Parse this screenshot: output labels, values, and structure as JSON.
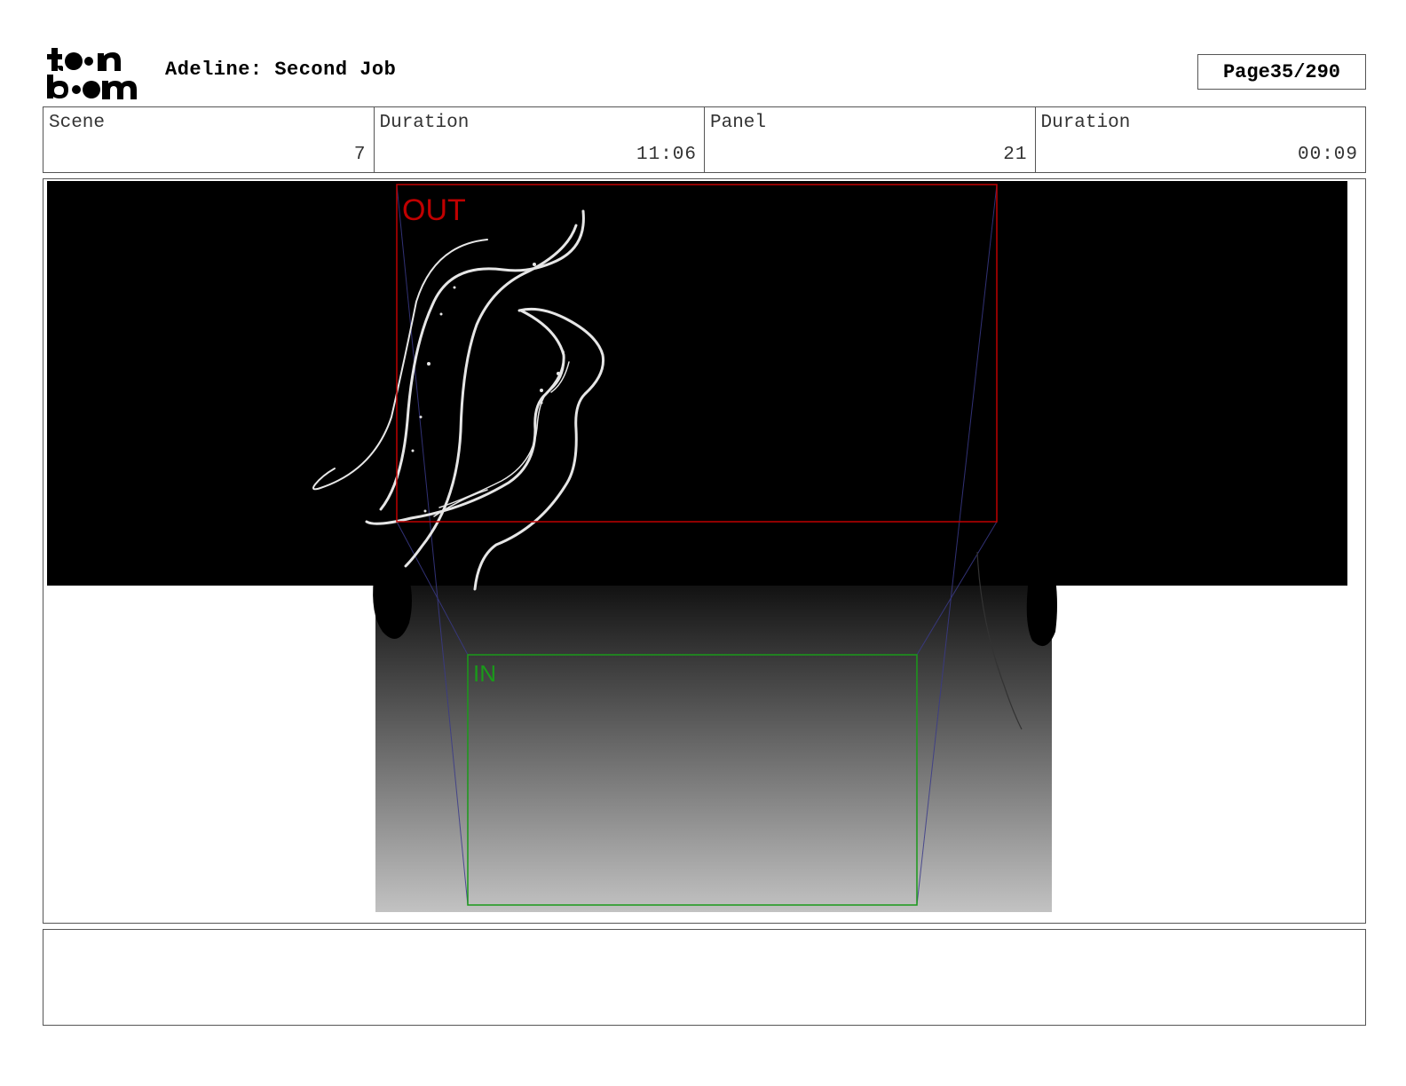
{
  "header": {
    "logo_text": "toon boom",
    "title": "Adeline: Second Job",
    "page_label": "Page",
    "page_value": "35/290"
  },
  "info": {
    "scene_label": "Scene",
    "scene_value": "7",
    "scene_duration_label": "Duration",
    "scene_duration_value": "11:06",
    "panel_label": "Panel",
    "panel_value": "21",
    "panel_duration_label": "Duration",
    "panel_duration_value": "00:09"
  },
  "frame": {
    "out_label": "OUT",
    "in_label": "IN",
    "out_color": "#c00000",
    "in_color": "#1a9a1a",
    "guide_color": "#3a3a8a"
  },
  "notes": {
    "text": ""
  }
}
